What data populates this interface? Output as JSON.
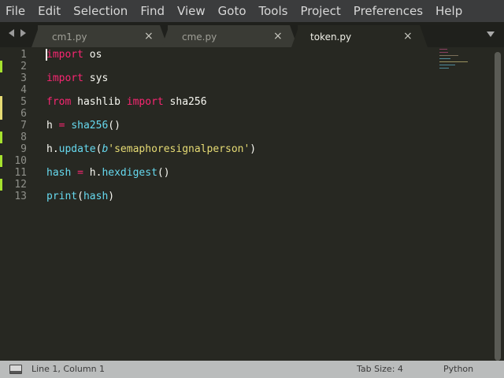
{
  "menu": [
    "File",
    "Edit",
    "Selection",
    "Find",
    "View",
    "Goto",
    "Tools",
    "Project",
    "Preferences",
    "Help"
  ],
  "tabs": [
    {
      "label": "cm1.py",
      "close": "×",
      "active": false
    },
    {
      "label": "cme.py",
      "close": "×",
      "active": false
    },
    {
      "label": "token.py",
      "close": "×",
      "active": true
    }
  ],
  "editor": {
    "line_numbers": [
      "1",
      "2",
      "3",
      "4",
      "5",
      "6",
      "7",
      "8",
      "9",
      "10",
      "11",
      "12",
      "13"
    ],
    "lines": {
      "l1": {
        "t1": "import",
        "t2": " os"
      },
      "l3": {
        "t1": "import",
        "t2": " sys"
      },
      "l5": {
        "t1": "from",
        "t2": " hashlib ",
        "t3": "import",
        "t4": " sha256"
      },
      "l7": {
        "t1": "h ",
        "t2": "=",
        "t3": " ",
        "t4": "sha256",
        "t5": "()"
      },
      "l9": {
        "t1": "h.",
        "t2": "update",
        "t3": "(",
        "t4": "b",
        "t5": "'semaphoresignalperson'",
        "t6": ")"
      },
      "l11": {
        "t1": "hash",
        "t2": " ",
        "t3": "=",
        "t4": " h.",
        "t5": "hexdigest",
        "t6": "()"
      },
      "l13": {
        "t1": "print",
        "t2": "(",
        "t3": "hash",
        "t4": ")"
      }
    },
    "modified_line_color": "#a6e22e",
    "changed_line_color": "#e6db74"
  },
  "status": {
    "position": "Line 1, Column 1",
    "tab_size": "Tab Size: 4",
    "syntax": "Python"
  },
  "colors": {
    "background": "#272822",
    "keyword": "#f92672",
    "function": "#66d9ef",
    "string": "#e6db74",
    "line_number": "#8f908a"
  }
}
